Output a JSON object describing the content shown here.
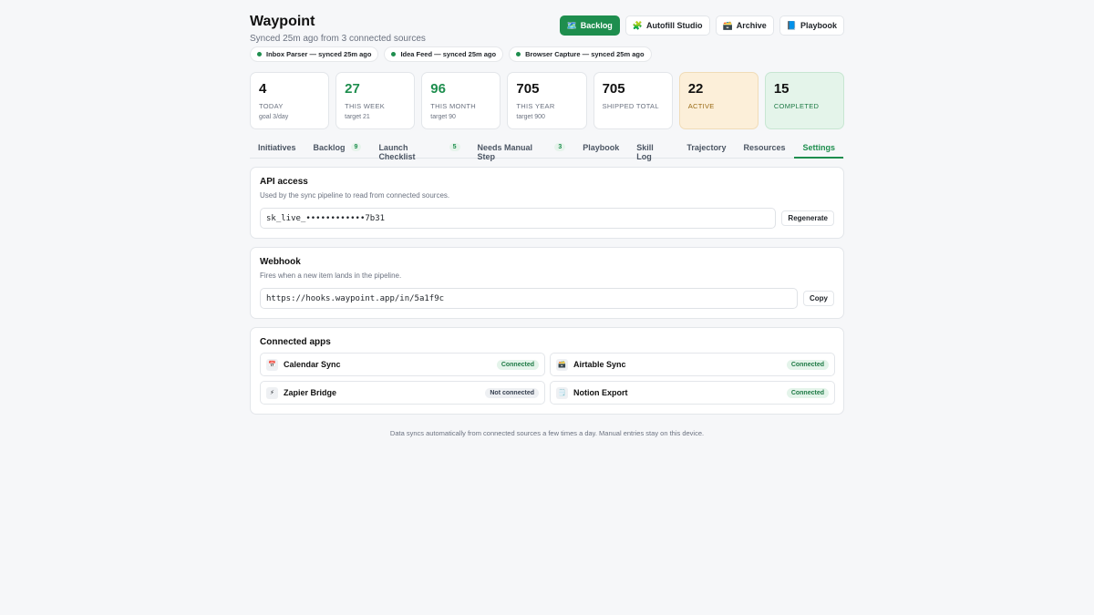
{
  "header": {
    "title": "Waypoint",
    "subtitle": "Synced 25m ago from 3 connected sources"
  },
  "actions": [
    {
      "icon": "🗺️",
      "icon_name": "map-icon",
      "label": "Backlog",
      "primary": true
    },
    {
      "icon": "🧩",
      "icon_name": "puzzle-icon",
      "label": "Autofill Studio",
      "primary": false
    },
    {
      "icon": "🗃️",
      "icon_name": "card-box-icon",
      "label": "Archive",
      "primary": false
    },
    {
      "icon": "📘",
      "icon_name": "blue-book-icon",
      "label": "Playbook",
      "primary": false
    }
  ],
  "sources": [
    {
      "label": "Inbox Parser — synced 25m ago"
    },
    {
      "label": "Idea Feed — synced 25m ago"
    },
    {
      "label": "Browser Capture — synced 25m ago"
    }
  ],
  "stats": [
    {
      "value": "4",
      "label": "TODAY",
      "sub": "goal 3/day",
      "variant": "plain"
    },
    {
      "value": "27",
      "label": "THIS WEEK",
      "sub": "target 21",
      "variant": "green"
    },
    {
      "value": "96",
      "label": "THIS MONTH",
      "sub": "target 90",
      "variant": "green"
    },
    {
      "value": "705",
      "label": "THIS YEAR",
      "sub": "target 900",
      "variant": "plain"
    },
    {
      "value": "705",
      "label": "SHIPPED TOTAL",
      "sub": "",
      "variant": "plain"
    },
    {
      "value": "22",
      "label": "ACTIVE",
      "sub": "",
      "variant": "active"
    },
    {
      "value": "15",
      "label": "COMPLETED",
      "sub": "",
      "variant": "completed"
    }
  ],
  "tabs": [
    {
      "label": "Initiatives",
      "badge": ""
    },
    {
      "label": "Backlog",
      "badge": "9"
    },
    {
      "label": "Launch Checklist",
      "badge": "5"
    },
    {
      "label": "Needs Manual Step",
      "badge": "3"
    },
    {
      "label": "Playbook",
      "badge": ""
    },
    {
      "label": "Skill Log",
      "badge": ""
    },
    {
      "label": "Trajectory",
      "badge": ""
    },
    {
      "label": "Resources",
      "badge": ""
    },
    {
      "label": "Settings",
      "badge": "",
      "selected": true
    }
  ],
  "api": {
    "title": "API access",
    "desc": "Used by the sync pipeline to read from connected sources.",
    "key": "sk_live_••••••••••••7b31",
    "button": "Regenerate"
  },
  "webhook": {
    "title": "Webhook",
    "desc": "Fires when a new item lands in the pipeline.",
    "url": "https://hooks.waypoint.app/in/5a1f9c",
    "button": "Copy"
  },
  "connected": {
    "title": "Connected apps",
    "apps": [
      {
        "icon": "📅",
        "icon_name": "calendar-icon",
        "name": "Calendar Sync",
        "status": "Connected",
        "on": true
      },
      {
        "icon": "🗃️",
        "icon_name": "card-box-icon",
        "name": "Airtable Sync",
        "status": "Connected",
        "on": true
      },
      {
        "icon": "⚡",
        "icon_name": "lightning-icon",
        "name": "Zapier Bridge",
        "status": "Not connected",
        "on": false
      },
      {
        "icon": "🗒️",
        "icon_name": "notepad-icon",
        "name": "Notion Export",
        "status": "Connected",
        "on": true
      }
    ]
  },
  "footer": "Data syncs automatically from connected sources a few times a day. Manual entries stay on this device.",
  "colors": {
    "accent": "#1e8e4e",
    "active_bg": "#fcefd9",
    "completed_bg": "#e4f4ea"
  }
}
